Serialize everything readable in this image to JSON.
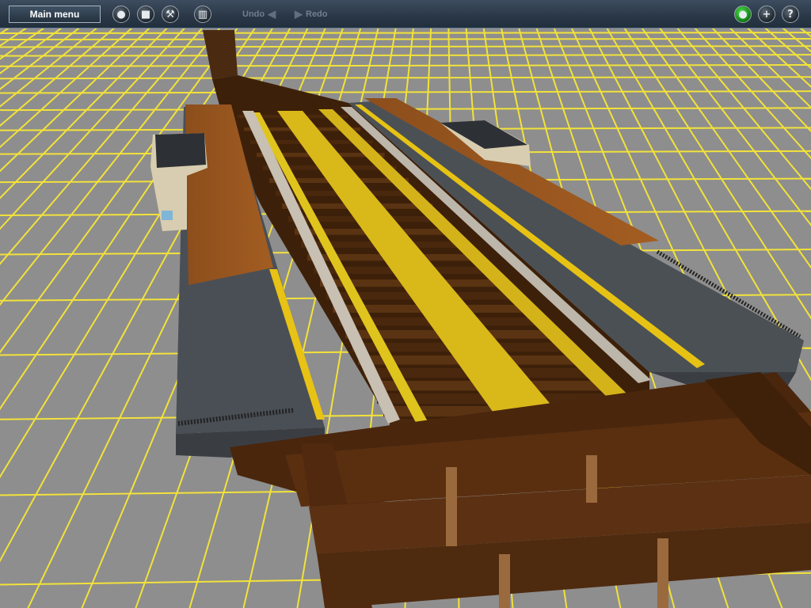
{
  "toolbar": {
    "main_menu_label": "Main menu",
    "undo_label": "Undo",
    "redo_label": "Redo",
    "icons": {
      "world": "globe-icon",
      "stop": "stop-icon",
      "tools": "wrench-icon",
      "trash": "trash-icon",
      "status": "status-green-icon",
      "add": "plus-icon",
      "help": "question-icon"
    },
    "status_color": "#1aa11a"
  },
  "scene": {
    "ground_color": "#8f8f8f",
    "grid_color": "#f2e23a",
    "sky_color": "#a9a9a9"
  }
}
